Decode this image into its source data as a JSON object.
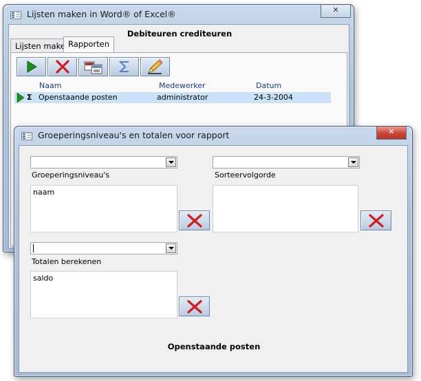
{
  "main_window": {
    "title": "Lijsten maken in Word® of Excel®",
    "close_glyph": "✕",
    "header": "Debiteuren crediteuren",
    "tabs": [
      {
        "label": "Lijsten maken",
        "active": false
      },
      {
        "label": "Rapporten",
        "active": true
      }
    ],
    "toolbar": [
      {
        "icon": "play-icon",
        "color": "#1f8f1f"
      },
      {
        "icon": "delete-icon",
        "color": "#d21d1d"
      },
      {
        "icon": "copy-icon",
        "color": "#b53030"
      },
      {
        "icon": "sum-icon",
        "color": "#5b7fc0"
      },
      {
        "icon": "edit-pencil-icon",
        "color": "#e8a030"
      }
    ],
    "columns": [
      "Naam",
      "Medewerker",
      "Datum"
    ],
    "rows": [
      {
        "sum_glyph": "Σ",
        "naam": "Openstaande posten",
        "medewerker": "administrator",
        "datum": "24-3-2004"
      }
    ]
  },
  "dialog": {
    "title": "Groeperingsniveau's en totalen voor rapport",
    "close_glyph": "✕",
    "grouping": {
      "combo_value": "",
      "label": "Groeperingsniveau's",
      "items": [
        "naam"
      ]
    },
    "sorting": {
      "combo_value": "",
      "label": "Sorteervolgorde",
      "items": []
    },
    "totals": {
      "combo_value": "",
      "label": "Totalen berekenen",
      "items": [
        "saldo"
      ]
    },
    "footer": "Openstaande posten"
  },
  "colors": {
    "accent_blue": "#1e3c8c",
    "selection": "#c9e2f7",
    "close_red": "#c9473a"
  }
}
